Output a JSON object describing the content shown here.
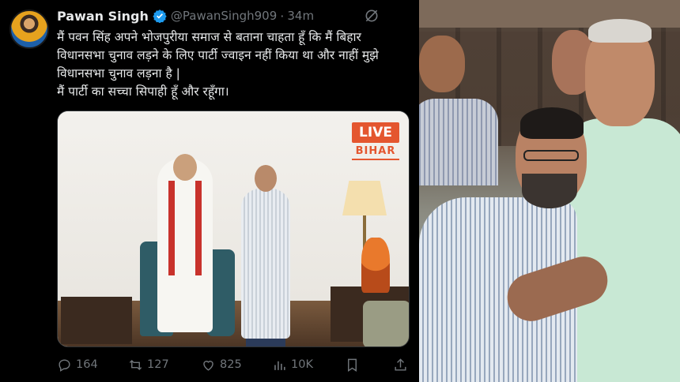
{
  "tweet": {
    "author": {
      "display_name": "Pawan Singh",
      "handle": "@PawanSingh909",
      "verified": true,
      "verified_color": "#1d9bf0"
    },
    "separator": "·",
    "time": "34m",
    "text_lines": [
      "मैं पवन सिंह अपने भोजपुरीया समाज से बताना चाहता हूँ कि मैं बिहार",
      "विधानसभा चुनाव लड़ने के लिए पार्टी ज्वाइन नहीं किया था और नाहीं मुझे",
      "विधानसभा चुनाव लड़ना है |",
      "मैं पार्टी का सच्चा सिपाही हूँ और रहूँगा।"
    ],
    "media": {
      "watermark_top": "LIVE",
      "watermark_bottom": "BIHAR",
      "watermark_color": "#e4562f"
    },
    "actions": {
      "replies": "164",
      "reposts": "127",
      "likes": "825",
      "views": "10K"
    },
    "icons": [
      "grok-icon",
      "reply-icon",
      "repost-icon",
      "like-icon",
      "views-icon",
      "bookmark-icon",
      "share-icon"
    ]
  },
  "theme": {
    "background": "#000000",
    "text": "#e7e9ea",
    "muted": "#71767b"
  }
}
